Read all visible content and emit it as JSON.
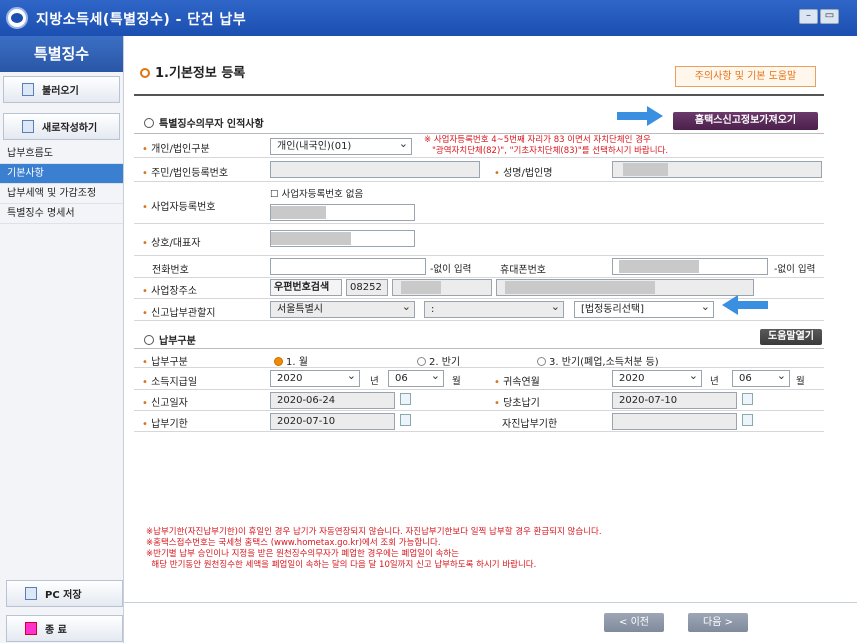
{
  "window": {
    "title": "지방소득세(특별징수) - 단건 납부",
    "min": "–",
    "max": "▭"
  },
  "sidebar": {
    "header": "특별징수",
    "load": "불러오기",
    "new": "새로작성하기",
    "items": [
      "납부흐름도",
      "기본사항",
      "납부세액 및 가감조정",
      "특별징수 명세서"
    ],
    "save": "PC 저장",
    "exit": "종 료"
  },
  "page": {
    "title": "1.기본정보 등록",
    "help": "주의사항 및 기본 도움말"
  },
  "sec1": {
    "title": "특별징수의무자 인적사항",
    "hometax_btn": "홈택스신고정보가져오기",
    "person_type_label": "개인/법인구분",
    "person_type_value": "개인(내국인)(01)",
    "warn1": "※ 사업자등록번호 4~5번째 자리가 83 이면서 자치단체인 경우",
    "warn2": "\"광역자치단체(82)\", \"기초자치단체(83)\"를 선택하시기 바랍니다.",
    "rrn_label": "주민/법인등록번호",
    "name_label": "성명/법인명",
    "biz_no_label": "사업자등록번호",
    "no_biz_no": "사업자등록번호 없음",
    "company_label": "상호/대표자",
    "phone_label": "전화번호",
    "no_dash": "-없이 입력",
    "mobile_label": "휴대폰번호",
    "addr_label": "사업장주소",
    "zip_btn": "우편번호검색",
    "zip": "08252",
    "office_label": "신고납부관할지",
    "city": "서울특별시",
    "district": ":",
    "dong": "[법정동리선택]"
  },
  "sec2": {
    "title": "납부구분",
    "help_btn": "도움말열기",
    "pay_type_label": "납부구분",
    "radios": [
      "1. 월",
      "2. 반기",
      "3. 반기(폐업,소득처분 등)"
    ],
    "income_label": "소득지급일",
    "year": "2020",
    "year_unit": "년",
    "month": "06",
    "month_unit": "월",
    "belong_label": "귀속연월",
    "belong_year": "2020",
    "belong_month": "06",
    "report_label": "신고일자",
    "report_date": "2020-06-24",
    "orig_label": "당초납기",
    "orig_date": "2020-07-10",
    "due_label": "납부기한",
    "due_date": "2020-07-10",
    "self_due_label": "자진납부기한"
  },
  "notes": [
    "※납부기한(자진납부기한)이 휴일인 경우 납기가 자동연장되지 않습니다. 자진납부기한보다 일찍 납부할 경우 환급되지 않습니다.",
    "※홈택스접수번호는 국세청 홈택스 (www.hometax.go.kr)에서 조회 가능합니다.",
    "※반기별 납부 승인이나 지정을 받은 원천징수의무자가 폐업한 경우에는 폐업일이 속하는",
    "  해당 반기동안 원천징수한 세액을 폐업일이 속하는 달의 다음 달 10일까지 신고 납부하도록 하시기 바랍니다."
  ],
  "footer": {
    "prev": "< 이전",
    "next": "다음 >"
  }
}
